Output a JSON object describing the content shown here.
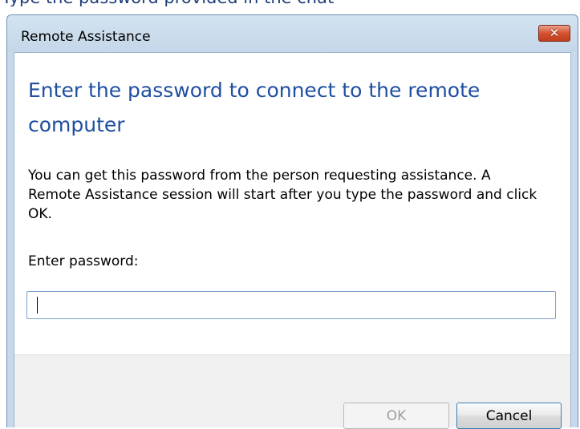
{
  "background_text": "Type the password provided in the chat",
  "window": {
    "title": "Remote Assistance",
    "close_icon": "close-icon",
    "close_symbol": "✕"
  },
  "content": {
    "heading": "Enter the password to connect to the remote computer",
    "description": "You can get this password from the person requesting assistance.  A Remote Assistance session will start after you type the password and click OK.",
    "password_label": "Enter password:",
    "password_value": ""
  },
  "buttons": {
    "ok": "OK",
    "cancel": "Cancel"
  },
  "colors": {
    "heading": "#1f4fa0",
    "titlebar": "#c7d9ea",
    "close_button": "#d4532f",
    "footer": "#f0f0f0",
    "disabled_text": "#a0a0a0"
  }
}
